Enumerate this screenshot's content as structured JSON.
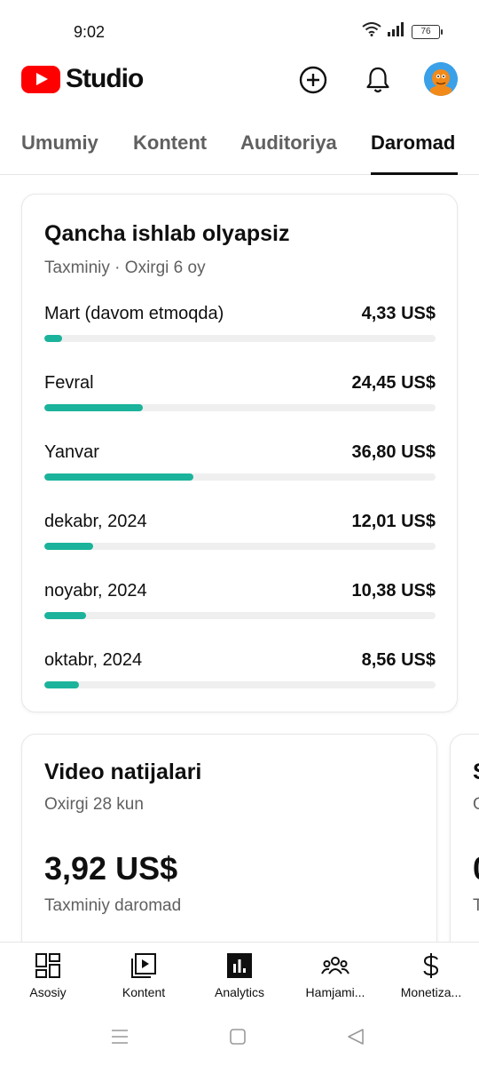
{
  "status_bar": {
    "time": "9:02",
    "battery": "76"
  },
  "header": {
    "app_name": "Studio",
    "icons": [
      "create-icon",
      "bell-icon",
      "avatar"
    ]
  },
  "tabs": [
    {
      "label": "Umumiy",
      "active": false
    },
    {
      "label": "Kontent",
      "active": false
    },
    {
      "label": "Auditoriya",
      "active": false
    },
    {
      "label": "Daromad",
      "active": true
    }
  ],
  "earnings_card": {
    "title": "Qancha ishlab olyapsiz",
    "subtitle": "Taxminiy · Oxirgi 6 oy",
    "rows": [
      {
        "label": "Mart (davom etmoqda)",
        "value": "4,33 US$",
        "amount": 4.33
      },
      {
        "label": "Fevral",
        "value": "24,45 US$",
        "amount": 24.45
      },
      {
        "label": "Yanvar",
        "value": "36,80 US$",
        "amount": 36.8
      },
      {
        "label": "dekabr, 2024",
        "value": "12,01 US$",
        "amount": 12.01
      },
      {
        "label": "noyabr, 2024",
        "value": "10,38 US$",
        "amount": 10.38
      },
      {
        "label": "oktabr, 2024",
        "value": "8,56 US$",
        "amount": 8.56
      }
    ],
    "bar_color": "#1bb39b"
  },
  "video_card": {
    "title": "Video natijalari",
    "subtitle": "Oxirgi 28 kun",
    "value": "3,92 US$",
    "caption": "Taxminiy daromad"
  },
  "peek_card": {
    "title_fragment": "S",
    "subtitle_fragment": "O",
    "value_fragment": "0",
    "caption_fragment": "T"
  },
  "bottom_nav": [
    {
      "label": "Asosiy",
      "icon": "dashboard-icon",
      "active": false
    },
    {
      "label": "Kontent",
      "icon": "content-icon",
      "active": false
    },
    {
      "label": "Analytics",
      "icon": "analytics-icon",
      "active": true
    },
    {
      "label": "Hamjami...",
      "icon": "community-icon",
      "active": false
    },
    {
      "label": "Monetiza...",
      "icon": "dollar-icon",
      "active": false
    }
  ],
  "colors": {
    "brand_red": "#ff0000",
    "accent_teal": "#1bb39b",
    "text_primary": "#0f0f0f",
    "text_secondary": "#606060"
  }
}
